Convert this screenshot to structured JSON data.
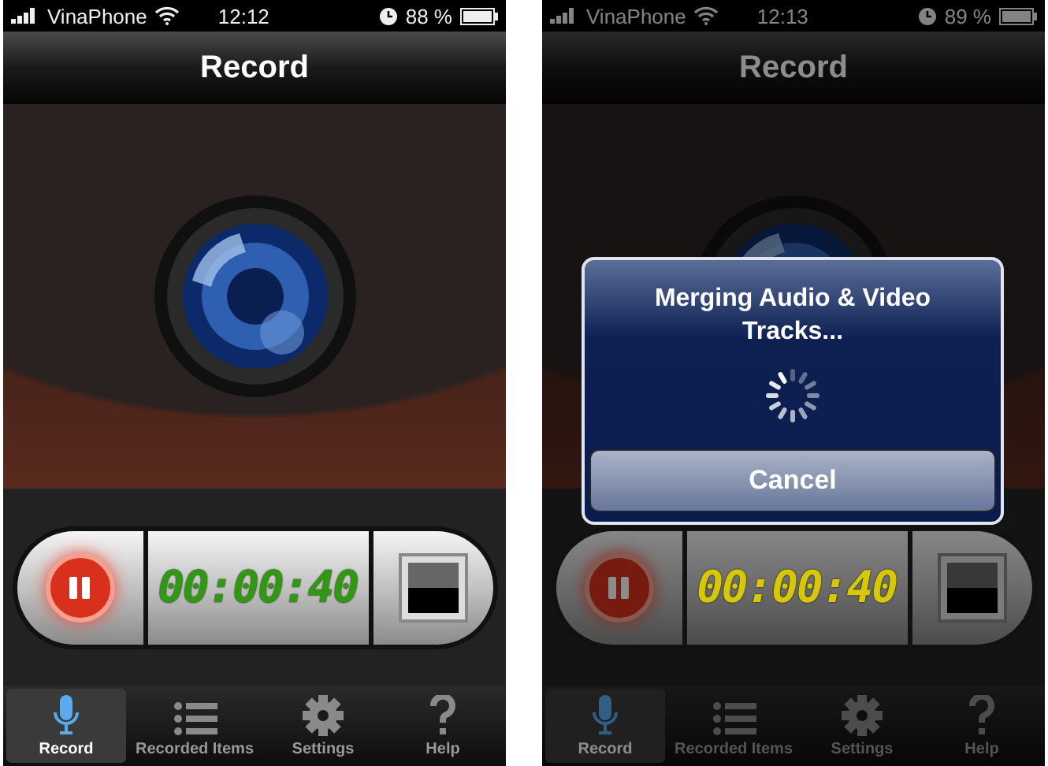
{
  "screens": [
    {
      "status": {
        "carrier": "VinaPhone",
        "time": "12:12",
        "battery": "88 %"
      },
      "title": "Record",
      "timer": {
        "text": "00:00:40",
        "color": "#2f9a10"
      },
      "tabs": [
        {
          "kind": "mic",
          "label": "Record",
          "selected": true
        },
        {
          "kind": "list",
          "label": "Recorded Items",
          "selected": false
        },
        {
          "kind": "gear",
          "label": "Settings",
          "selected": false
        },
        {
          "kind": "help",
          "label": "Help",
          "selected": false
        }
      ]
    },
    {
      "status": {
        "carrier": "VinaPhone",
        "time": "12:13",
        "battery": "89 %"
      },
      "title": "Record",
      "timer": {
        "text": "00:00:40",
        "color": "#d8c800"
      },
      "tabs": [
        {
          "kind": "mic",
          "label": "Record",
          "selected": true
        },
        {
          "kind": "list",
          "label": "Recorded Items",
          "selected": false
        },
        {
          "kind": "gear",
          "label": "Settings",
          "selected": false
        },
        {
          "kind": "help",
          "label": "Help",
          "selected": false
        }
      ],
      "dialog": {
        "message": "Merging Audio & Video Tracks...",
        "button": "Cancel"
      }
    }
  ]
}
